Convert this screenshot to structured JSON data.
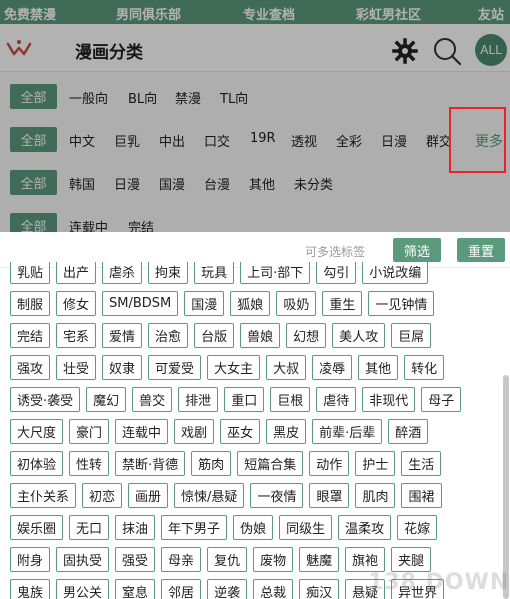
{
  "top_nav": [
    "免费禁漫",
    "男同俱乐部",
    "专业查档",
    "彩虹男社区",
    "友站"
  ],
  "header": {
    "title": "漫画分类",
    "all_label": "ALL"
  },
  "filters": {
    "all_label": "全部",
    "rows": [
      [
        "一般向",
        "BL向",
        "禁漫",
        "TL向"
      ],
      [
        "中文",
        "巨乳",
        "中出",
        "口交",
        "19R",
        "透视",
        "全彩",
        "日漫",
        "群交"
      ],
      [
        "韩国",
        "日漫",
        "国漫",
        "台漫",
        "其他",
        "未分类"
      ],
      [
        "连载中",
        "完结"
      ]
    ],
    "more_label": "更多"
  },
  "actions": {
    "hint": "可多选标签",
    "filter_label": "筛选",
    "reset_label": "重置"
  },
  "tags": [
    [
      "乳贴",
      "出产",
      "虐杀",
      "拘束",
      "玩具",
      "上司·部下",
      "勾引",
      "小说改编"
    ],
    [
      "制服",
      "修女",
      "SM/BDSM",
      "国漫",
      "狐娘",
      "吸奶",
      "重生",
      "一见钟情"
    ],
    [
      "完结",
      "宅系",
      "爱情",
      "治愈",
      "台版",
      "兽娘",
      "幻想",
      "美人攻",
      "巨屌"
    ],
    [
      "强攻",
      "壮受",
      "奴隶",
      "可爱受",
      "大女主",
      "大叔",
      "凌辱",
      "其他",
      "转化"
    ],
    [
      "诱受·袭受",
      "魔幻",
      "兽交",
      "排泄",
      "重口",
      "巨根",
      "虐待",
      "非现代",
      "母子"
    ],
    [
      "大尺度",
      "豪门",
      "连载中",
      "戏剧",
      "巫女",
      "黑皮",
      "前辈·后辈",
      "醉酒"
    ],
    [
      "初体验",
      "性转",
      "禁断·背德",
      "筋肉",
      "短篇合集",
      "动作",
      "护士",
      "生活"
    ],
    [
      "主仆关系",
      "初恋",
      "画册",
      "惊悚/悬疑",
      "一夜情",
      "眼罩",
      "肌肉",
      "围裙"
    ],
    [
      "娱乐圈",
      "无口",
      "抹油",
      "年下男子",
      "伪娘",
      "同级生",
      "温柔攻",
      "花嫁"
    ],
    [
      "附身",
      "固执受",
      "强受",
      "母亲",
      "复仇",
      "废物",
      "魅魔",
      "旗袍",
      "夹腿"
    ],
    [
      "鬼族",
      "男公关",
      "窒息",
      "邻居",
      "逆袭",
      "总裁",
      "痴汉",
      "悬疑",
      "异世界"
    ]
  ],
  "watermark": "138 DOWN"
}
